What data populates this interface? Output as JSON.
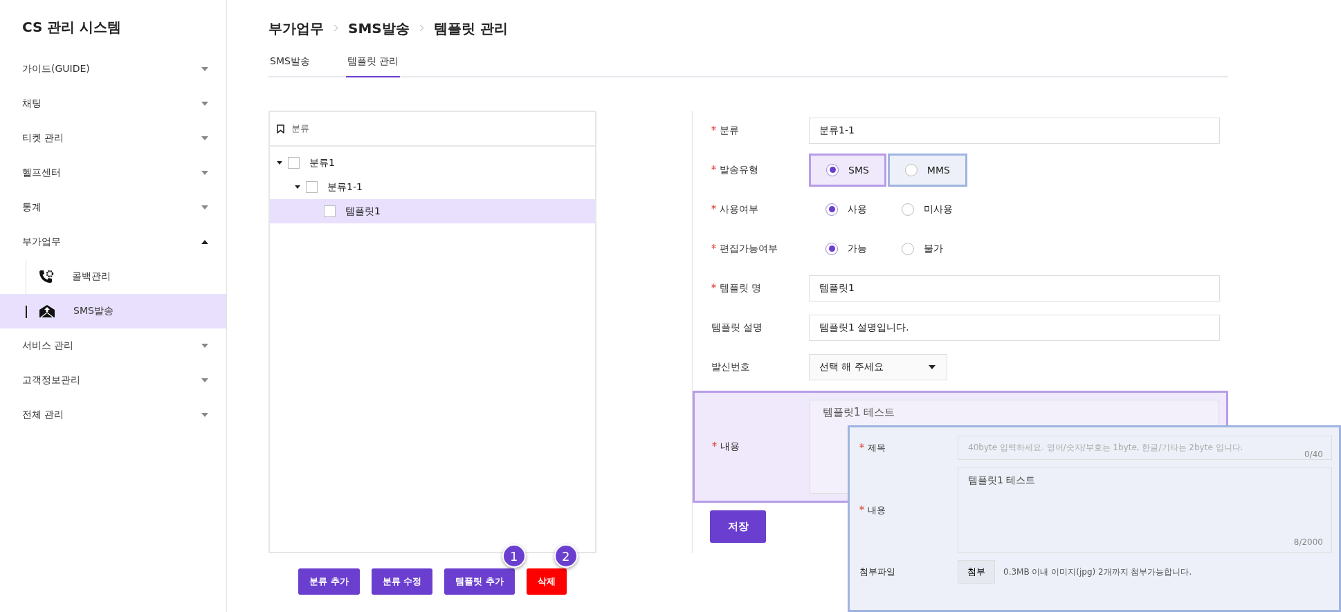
{
  "sidebar": {
    "title": "CS 관리 시스템",
    "items": [
      {
        "label": "가이드(GUIDE)",
        "expanded": false
      },
      {
        "label": "채팅",
        "expanded": false
      },
      {
        "label": "티켓 관리",
        "expanded": false
      },
      {
        "label": "헬프센터",
        "expanded": false
      },
      {
        "label": "통계",
        "expanded": false
      },
      {
        "label": "부가업무",
        "expanded": true,
        "children": [
          {
            "label": "콜백관리",
            "kind": "callback",
            "selected": false
          },
          {
            "label": "SMS발송",
            "kind": "mail",
            "selected": true
          }
        ]
      },
      {
        "label": "서비스 관리",
        "expanded": false
      },
      {
        "label": "고객정보관리",
        "expanded": false
      },
      {
        "label": "전체 관리",
        "expanded": false
      }
    ]
  },
  "breadcrumb": [
    "부가업무",
    "SMS발송",
    "템플릿 관리"
  ],
  "tabs": [
    {
      "label": "SMS발송",
      "selected": false
    },
    {
      "label": "템플릿 관리",
      "selected": true
    }
  ],
  "tree": {
    "header": "분류",
    "nodes": [
      {
        "label": "분류1",
        "checked": false,
        "expanded": true,
        "selected": false,
        "children": [
          {
            "label": "분류1-1",
            "checked": false,
            "expanded": true,
            "selected": false,
            "children": [
              {
                "label": "템플릿1",
                "checked": false,
                "selected": true
              }
            ]
          }
        ]
      }
    ]
  },
  "form": {
    "rows": [
      {
        "kind": "text",
        "label": "분류",
        "required": true,
        "value": "분류1-1"
      },
      {
        "kind": "radio",
        "label": "발송유형",
        "required": true,
        "options": [
          {
            "label": "SMS",
            "selected": true,
            "color": "#b79ce8"
          },
          {
            "label": "MMS",
            "selected": false,
            "color": "#9fb4e0"
          }
        ]
      },
      {
        "kind": "radio",
        "label": "사용여부",
        "required": true,
        "options": [
          {
            "label": "사용",
            "selected": true
          },
          {
            "label": "미사용",
            "selected": false
          }
        ]
      },
      {
        "kind": "radio",
        "label": "편집가능여부",
        "required": true,
        "options": [
          {
            "label": "가능",
            "selected": true
          },
          {
            "label": "불가",
            "selected": false
          }
        ]
      },
      {
        "kind": "text",
        "label": "템플릿 명",
        "required": true,
        "value": "템플릿1"
      },
      {
        "kind": "text",
        "label": "템플릿 설명",
        "required": false,
        "value": "템플릿1 설명입니다."
      },
      {
        "kind": "select",
        "label": "발신번호",
        "required": false,
        "value": "선택 해 주세요"
      },
      {
        "kind": "textarea",
        "label": "내용",
        "required": true,
        "value": "템플릿1 테스트",
        "annotated": true
      }
    ],
    "save": "저장"
  },
  "buttons": [
    {
      "label": "분류 추가",
      "kind": "primary"
    },
    {
      "label": "분류 수정",
      "kind": "primary"
    },
    {
      "label": "템플릿 추가",
      "kind": "primary",
      "badge": "1"
    },
    {
      "label": "삭제",
      "kind": "danger",
      "badge": "2"
    }
  ],
  "overlay": {
    "fields": [
      {
        "kind": "text",
        "label": "제목",
        "required": true,
        "placeholder": "40byte 입력하세요. 영어/숫자/부호는 1byte, 한글/기타는 2byte 입니다.",
        "counter": "0/40"
      },
      {
        "kind": "textarea",
        "label": "내용",
        "required": true,
        "value": "템플릿1 테스트",
        "counter": "8/2000"
      },
      {
        "kind": "file",
        "label": "첨부파일",
        "required": false,
        "button": "첨부",
        "hint": "0.3MB 이내 이미지(jpg) 2개까지 첨부가능합니다."
      }
    ]
  }
}
